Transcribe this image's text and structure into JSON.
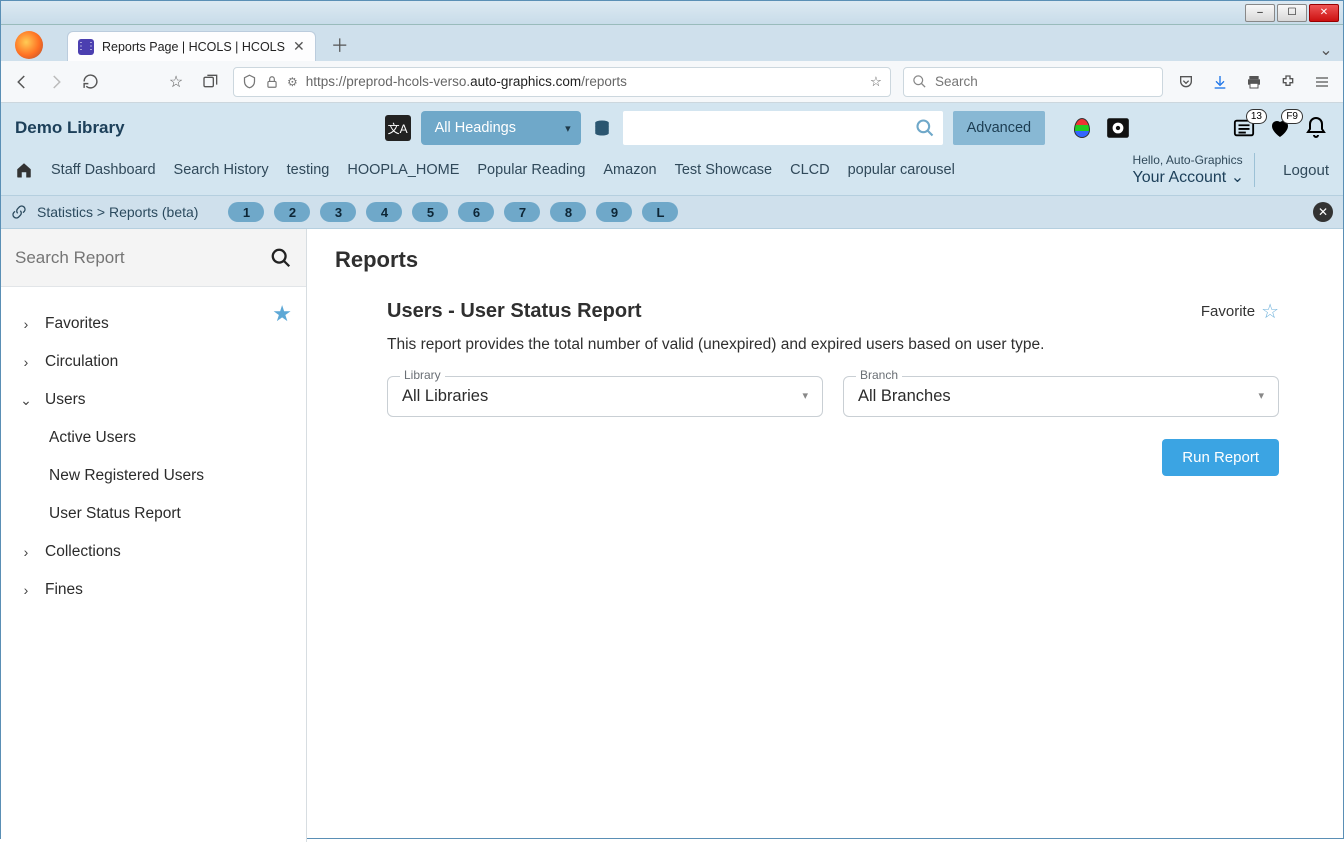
{
  "window": {
    "tab_title": "Reports Page | HCOLS | HCOLS"
  },
  "browser": {
    "url_prefix": "https://preprod-hcols-verso.",
    "url_host": "auto-graphics.com",
    "url_path": "/reports",
    "search_placeholder": "Search"
  },
  "header": {
    "library_name": "Demo Library",
    "headings_label": "All Headings",
    "advanced_label": "Advanced",
    "badge_list": "13",
    "badge_fav": "F9",
    "hello_text": "Hello, Auto-Graphics",
    "account_text": "Your Account",
    "logout": "Logout",
    "nav_links": [
      "Staff Dashboard",
      "Search History",
      "testing",
      "HOOPLA_HOME",
      "Popular Reading",
      "Amazon",
      "Test Showcase",
      "CLCD",
      "popular carousel"
    ]
  },
  "crumbs": {
    "text": "Statistics  >  Reports (beta)",
    "pills": [
      "1",
      "2",
      "3",
      "4",
      "5",
      "6",
      "7",
      "8",
      "9",
      "L"
    ]
  },
  "sidebar": {
    "search_placeholder": "Search Report",
    "items": {
      "favorites": "Favorites",
      "circulation": "Circulation",
      "users": "Users",
      "users_children": [
        "Active Users",
        "New Registered Users",
        "User Status Report"
      ],
      "collections": "Collections",
      "fines": "Fines"
    }
  },
  "main": {
    "page_title": "Reports",
    "report_title": "Users - User Status Report",
    "favorite_label": "Favorite",
    "description": "This report provides the total number of valid (unexpired) and expired users based on user type.",
    "library_label": "Library",
    "library_value": "All Libraries",
    "branch_label": "Branch",
    "branch_value": "All Branches",
    "run_label": "Run Report"
  }
}
